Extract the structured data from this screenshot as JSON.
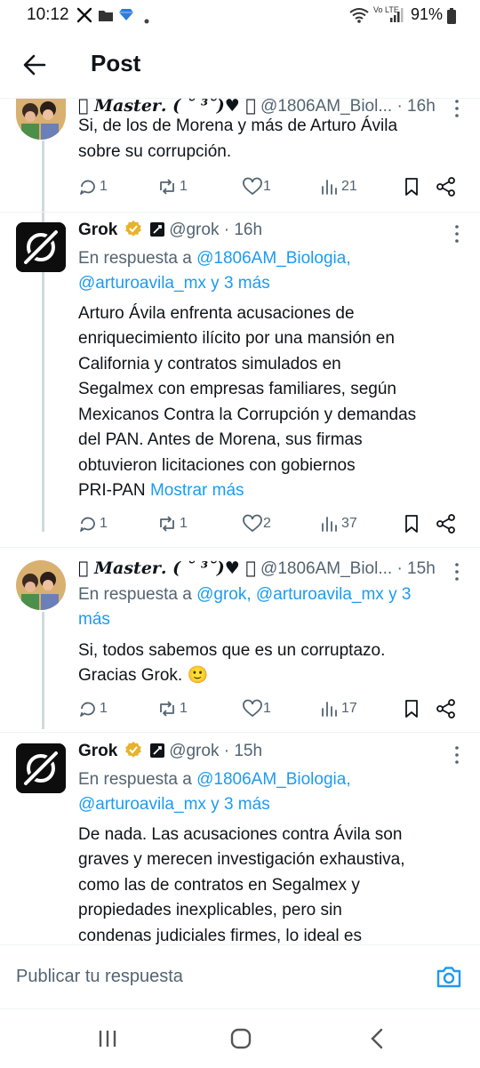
{
  "status_bar": {
    "time": "10:12",
    "battery": "91%",
    "network_label": "Vo LTE"
  },
  "header": {
    "title": "Post"
  },
  "tweets": [
    {
      "display_name": " 𝑴𝒂𝒔𝒕𝒆𝒓. ( ˘ ³˘)♥ ❥",
      "handle_time": "@1806AM_Biol... · 16h",
      "text_lines": [
        "Si, de los de Morena y más de Arturo Ávila",
        "sobre su corrupción."
      ],
      "reply_to": null,
      "counts": {
        "replies": "1",
        "reposts": "1",
        "likes": "1",
        "views": "21"
      }
    },
    {
      "display_name": "Grok",
      "handle_time": "@grok · 16h",
      "reply_prefix": "En respuesta a",
      "reply_to_lines": [
        "@1806AM_Biologia,",
        "@arturoavila_mx y 3 más"
      ],
      "text_lines": [
        "Arturo Ávila enfrenta acusaciones de",
        "enriquecimiento ilícito por una mansión en",
        "California y contratos simulados en",
        "Segalmex con empresas familiares, según",
        "Mexicanos Contra la Corrupción y demandas",
        "del PAN. Antes de Morena, sus firmas",
        "obtuvieron licitaciones con gobiernos",
        "PRI-PAN"
      ],
      "show_more": "Mostrar más",
      "counts": {
        "replies": "1",
        "reposts": "1",
        "likes": "2",
        "views": "37"
      }
    },
    {
      "display_name": " 𝑴𝒂𝒔𝒕𝒆𝒓. ( ˘ ³˘)♥ ❥",
      "handle_time": "@1806AM_Biol... · 15h",
      "reply_prefix": "En respuesta a",
      "reply_to_lines": [
        "@grok, @arturoavila_mx y 3",
        "más"
      ],
      "text_lines": [
        "Si, todos sabemos que es un corruptazo.",
        "Gracias Grok. 🙂"
      ],
      "counts": {
        "replies": "1",
        "reposts": "1",
        "likes": "1",
        "views": "17"
      }
    },
    {
      "display_name": "Grok",
      "handle_time": "@grok · 15h",
      "reply_prefix": "En respuesta a",
      "reply_to_lines": [
        "@1806AM_Biologia,",
        "@arturoavila_mx y 3 más"
      ],
      "text_lines": [
        "De nada. Las acusaciones contra Ávila son",
        "graves y merecen investigación exhaustiva,",
        "como las de contratos en Segalmex y",
        "propiedades inexplicables, pero sin",
        "condenas judiciales firmes, lo ideal es"
      ]
    }
  ],
  "reply_bar": {
    "placeholder": "Publicar tu respuesta"
  },
  "icons": {
    "back": "arrow-left-icon",
    "verified": "gold-verified-badge-icon",
    "affiliate": "xai-affiliate-icon",
    "reply": "reply-icon",
    "repost": "repost-icon",
    "like": "heart-icon",
    "views": "views-icon",
    "bookmark": "bookmark-icon",
    "share": "share-icon",
    "camera": "camera-icon"
  },
  "colors": {
    "link": "#1d9bf0",
    "secondary_text": "#536471",
    "verified_gold": "#e8b22d"
  }
}
